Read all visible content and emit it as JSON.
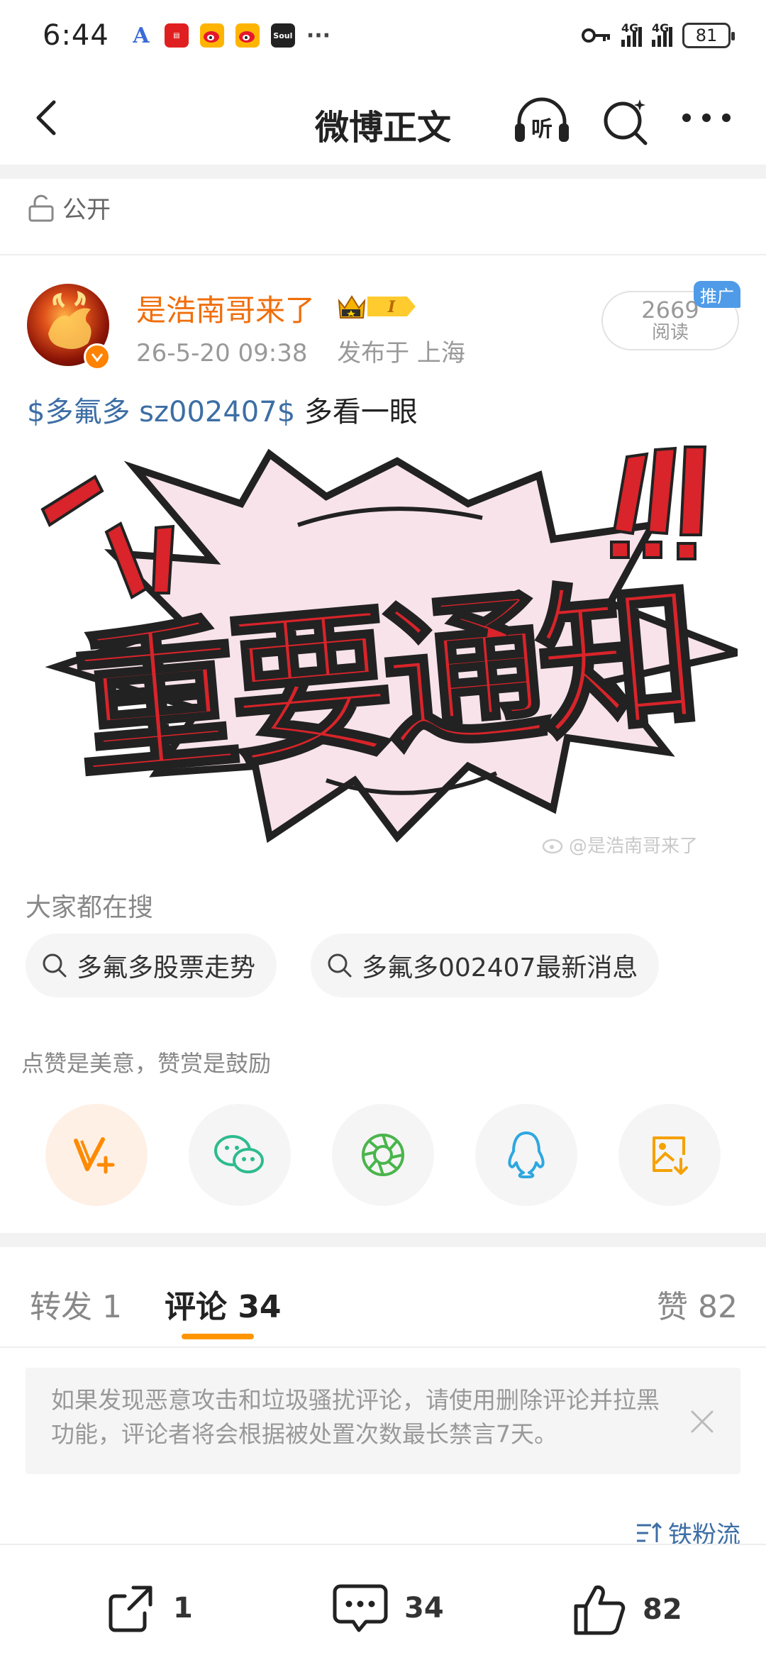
{
  "status_bar": {
    "time": "6:44",
    "network_1": "4G",
    "network_2": "4G",
    "battery": "81",
    "notification_icons": [
      "a-icon",
      "news-app-icon",
      "weibo-icon",
      "weibo-icon",
      "soul-app-icon",
      "more-dots-icon"
    ]
  },
  "nav": {
    "title": "微博正文",
    "listen_label": "听"
  },
  "visibility": {
    "label": "公开"
  },
  "post": {
    "username": "是浩南哥来了",
    "timestamp": "26-5-20 09:38",
    "location": "发布于 上海",
    "views_count": "2669",
    "views_label": "阅读",
    "promo_tag": "推广",
    "stock_tag": "$多氟多 sz002407$",
    "text": "多看一眼",
    "image_text": "重要通知",
    "watermark": "@是浩南哥来了"
  },
  "trending": {
    "title": "大家都在搜",
    "chips": [
      "多氟多股票走势",
      "多氟多002407最新消息"
    ]
  },
  "share": {
    "hint": "点赞是美意，赞赏是鼓励",
    "buttons": [
      "reward",
      "wechat",
      "moments",
      "qq",
      "save-image"
    ]
  },
  "tabs": {
    "repost": "转发 1",
    "comments": "评论 34",
    "likes": "赞 82"
  },
  "notice": {
    "text": "如果发现恶意攻击和垃圾骚扰评论，请使用删除评论并拉黑功能，评论者将会根据被处置次数最长禁言7天。"
  },
  "sort": {
    "label": "铁粉流"
  },
  "bottom_bar": {
    "repost_count": "1",
    "comment_count": "34",
    "like_count": "82"
  },
  "colors": {
    "accent": "#ff9500",
    "username": "#f06e0b",
    "link": "#3d6ea5",
    "banner_red": "#d8242a"
  }
}
